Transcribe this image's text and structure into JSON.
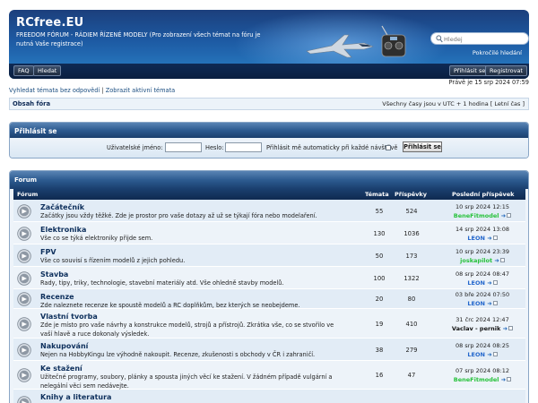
{
  "header": {
    "site_title": "RCfree.EU",
    "site_desc": "FREEDOM FÓRUM - RÁDIEM ŘÍZENÉ MODELY (Pro zobrazení všech témat na fóru je nutná Vaše registrace)",
    "search_placeholder": "Hledej",
    "advanced_search": "Pokročilé hledání",
    "nav": {
      "faq": "FAQ",
      "search": "Hledat",
      "login": "Přihlásit se",
      "register": "Registrovat"
    }
  },
  "date_line": "Právě je 15 srp 2024 07:59",
  "quick_links": {
    "unanswered": "Vyhledat témata bez odpovědí",
    "sep": "|",
    "active": "Zobrazit aktivní témata"
  },
  "breadcrumb": {
    "home": "Obsah fóra",
    "timezone": "Všechny časy jsou v UTC + 1 hodina [ Letní čas ]"
  },
  "login": {
    "title": "Přihlásit se",
    "username_label": "Uživatelské jméno:",
    "password_label": "Heslo:",
    "remember_label": "Přihlásit mě automaticky při každé návštěvě",
    "button": "Přihlásit se"
  },
  "forum": {
    "panel_title": "Forum",
    "columns": {
      "forum": "Fórum",
      "topics": "Témata",
      "posts": "Příspěvky",
      "last_post": "Poslední příspěvek"
    },
    "rows": [
      {
        "name": "Začátečník",
        "desc": "Začátky jsou vždy těžké. Zde je prostor pro vaše dotazy až už se týkají fóra nebo modelaření.",
        "topics": "55",
        "posts": "524",
        "last_date": "10 srp 2024 12:15",
        "last_user": "BeneFitmodel",
        "user_color": "#27c23b"
      },
      {
        "name": "Elektronika",
        "desc": "Vše co se týká elektroniky přijde sem.",
        "topics": "130",
        "posts": "1036",
        "last_date": "14 srp 2024 13:08",
        "last_user": "LEON",
        "user_color": "#2266cc"
      },
      {
        "name": "FPV",
        "desc": "Vše co souvisí s řízením modelů z jejich pohledu.",
        "topics": "50",
        "posts": "173",
        "last_date": "10 srp 2024 23:39",
        "last_user": "joskapilot",
        "user_color": "#27c23b"
      },
      {
        "name": "Stavba",
        "desc": "Rady, tipy, triky, technologie, stavební materiály atd. Vše ohledně stavby modelů.",
        "topics": "100",
        "posts": "1322",
        "last_date": "08 srp 2024 08:47",
        "last_user": "LEON",
        "user_color": "#2266cc"
      },
      {
        "name": "Recenze",
        "desc": "Zde naleznete recenze ke spoustě modelů a RC doplňkům, bez kterých se neobejdeme.",
        "topics": "20",
        "posts": "80",
        "last_date": "03 bře 2024 07:50",
        "last_user": "LEON",
        "user_color": "#2266cc"
      },
      {
        "name": "Vlastní tvorba",
        "desc": "Zde je místo pro vaše návrhy a konstrukce modelů, strojů a přístrojů. Zkrátka vše, co se stvořilo ve vaší hlavě a ruce dokonaly výsledek.",
        "topics": "19",
        "posts": "410",
        "last_date": "31 črc 2024 12:47",
        "last_user": "Vaclav - pernik",
        "user_color": "#111111"
      },
      {
        "name": "Nakupování",
        "desc": "Nejen na HobbyKingu lze výhodně nakoupit. Recenze, zkušenosti s obchody v ČR i zahraničí.",
        "topics": "38",
        "posts": "279",
        "last_date": "08 srp 2024 08:25",
        "last_user": "LEON",
        "user_color": "#2266cc"
      },
      {
        "name": "Ke stažení",
        "desc": "Užitečné programy, soubory, plánky a spousta jiných věcí ke stažení. V žádném případě vulgární a nelegální věci sem nedávejte.",
        "topics": "16",
        "posts": "47",
        "last_date": "07 srp 2024 08:12",
        "last_user": "BeneFitmodel",
        "user_color": "#27c23b"
      },
      {
        "name": "Knihy a literatura",
        "desc": "",
        "topics": "",
        "posts": "",
        "last_date": "",
        "last_user": "",
        "user_color": "#111111"
      }
    ]
  }
}
